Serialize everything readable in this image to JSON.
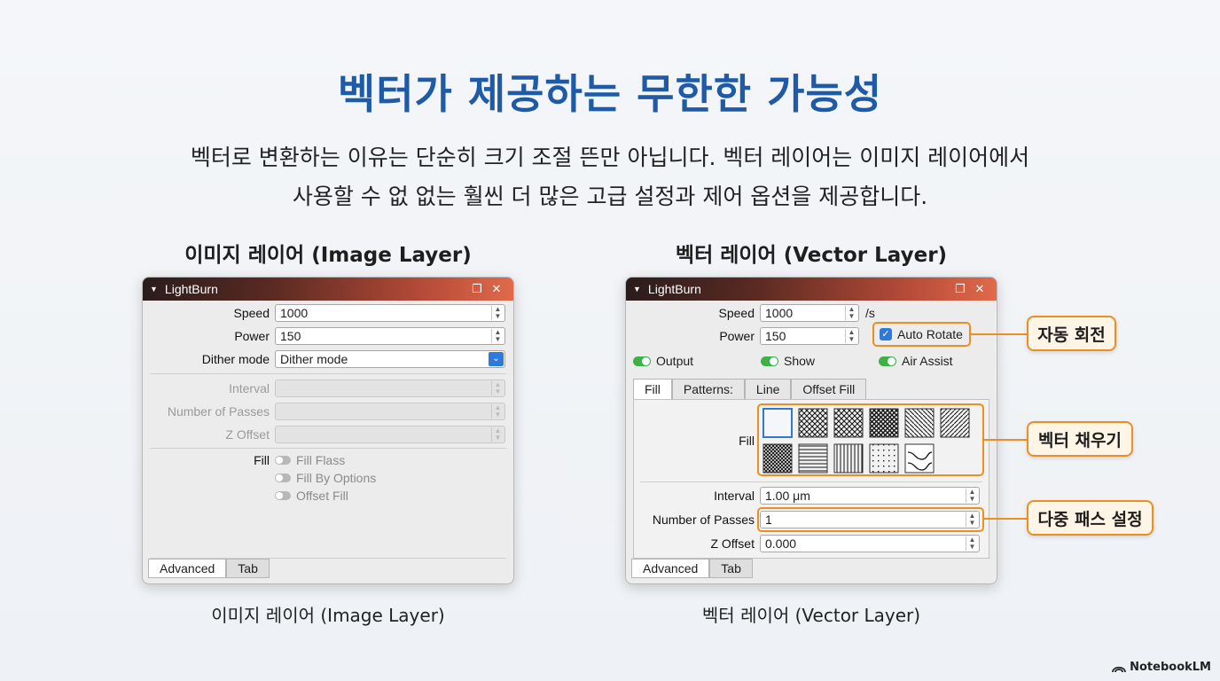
{
  "title": "벡터가 제공하는 무한한 가능성",
  "subtitle_line1": "벡터로 변환하는 이유는 단순히 크기 조절  뜬만 아닙니다. 벡터 레이어는 이미지 레이어에서",
  "subtitle_line2": "사용할 수 없 없는 훨씬 더 많은 고급 설정과 제어 옵션을 제공합니다.",
  "left": {
    "heading": "이미지 레이어 (Image Layer)",
    "caption": "이미지 레이어 (Image Layer)",
    "window_title": "LightBurn",
    "speed_label": "Speed",
    "speed_value": "1000",
    "power_label": "Power",
    "power_value": "150",
    "dither_label": "Dither mode",
    "dither_value": "Dither mode",
    "interval_label": "Interval",
    "passes_label": "Number of Passes",
    "zoffset_label": "Z Offset",
    "fill_label": "Fill",
    "fill_options": [
      "Fill Flass",
      "Fill By Options",
      "Offset Fill"
    ],
    "tab_advanced": "Advanced",
    "tab_tab": "Tab"
  },
  "right": {
    "heading": "벡터 레이어 (Vector Layer)",
    "caption": "벡터 레이어 (Vector Layer)",
    "window_title": "LightBurn",
    "speed_label": "Speed",
    "speed_value": "1000",
    "speed_unit": "/s",
    "power_label": "Power",
    "power_value": "150",
    "auto_rotate": "Auto Rotate",
    "output": "Output",
    "show": "Show",
    "air_assist": "Air Assist",
    "fill_tabs": [
      "Fill",
      "Patterns:",
      "Line",
      "Offset Fill"
    ],
    "fill_label": "Fill",
    "interval_label": "Interval",
    "interval_value": "1.00 μm",
    "passes_label": "Number of Passes",
    "passes_value": "1",
    "zoffset_label": "Z Offset",
    "zoffset_value": "0.000",
    "tab_advanced": "Advanced",
    "tab_tab": "Tab"
  },
  "callouts": {
    "auto_rotate": "자동 회전",
    "vector_fill": "벡터 채우기",
    "multi_pass": "다중 패스 설정"
  },
  "brand": "NotebookLM",
  "colors": {
    "title": "#1f5aa6",
    "accent": "#ee8e22",
    "toggle_on": "#3db048",
    "select": "#2f7ad8"
  }
}
